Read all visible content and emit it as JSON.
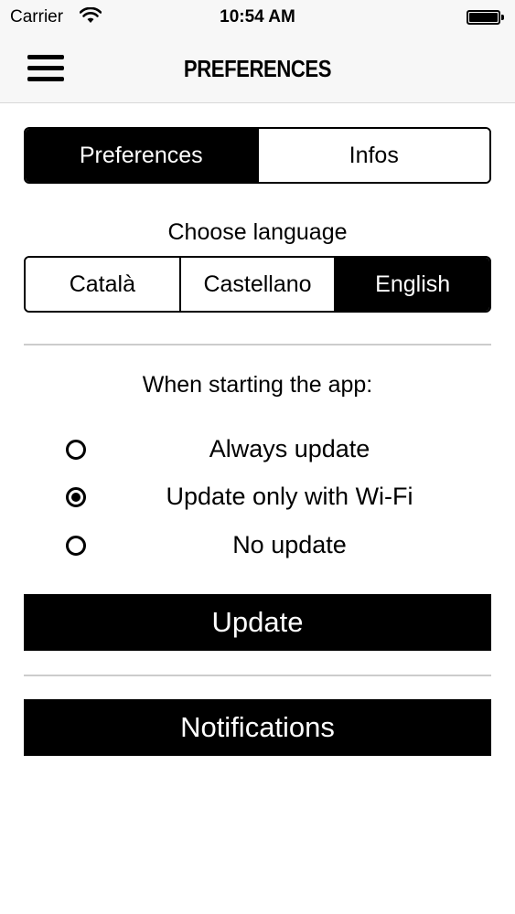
{
  "status_bar": {
    "carrier": "Carrier",
    "time": "10:54 AM",
    "wifi_icon": "wifi-icon",
    "battery_icon": "battery-icon"
  },
  "nav": {
    "title": "PREFERENCES",
    "menu_icon": "hamburger-menu-icon"
  },
  "top_tabs": [
    {
      "label": "Preferences",
      "selected": true
    },
    {
      "label": "Infos",
      "selected": false
    }
  ],
  "language": {
    "label": "Choose language",
    "options": [
      {
        "label": "Català",
        "selected": false
      },
      {
        "label": "Castellano",
        "selected": false
      },
      {
        "label": "English",
        "selected": true
      }
    ]
  },
  "startup": {
    "label": "When starting the app:",
    "options": [
      {
        "label": "Always update",
        "selected": false
      },
      {
        "label": "Update only with Wi-Fi",
        "selected": true
      },
      {
        "label": "No update",
        "selected": false
      }
    ]
  },
  "buttons": {
    "update": "Update",
    "notifications": "Notifications"
  },
  "colors": {
    "primary": "#000000",
    "background": "#ffffff",
    "bar_background": "#f7f7f7",
    "divider": "#cccccc"
  }
}
